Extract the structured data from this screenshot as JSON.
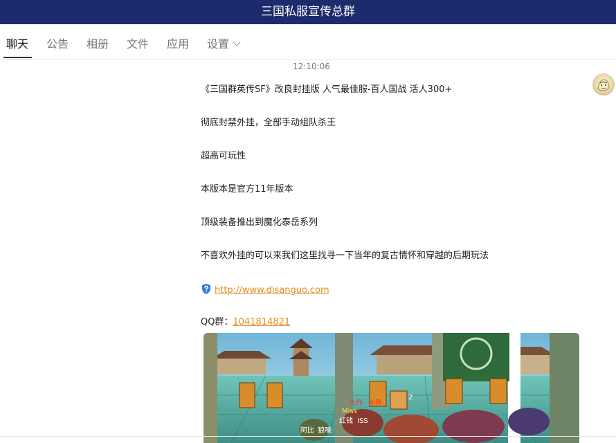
{
  "window": {
    "title": "三国私服宣传总群"
  },
  "tabs": [
    {
      "label": "聊天",
      "active": true
    },
    {
      "label": "公告"
    },
    {
      "label": "相册"
    },
    {
      "label": "文件"
    },
    {
      "label": "应用"
    },
    {
      "label": "设置"
    }
  ],
  "chat": {
    "timestamp": "12:10:06",
    "lines": [
      "《三国群英传SF》改良封挂版 人气最佳服-百人国战 活人300+",
      "彻底封禁外挂，全部手动组队杀王",
      "超高可玩性",
      "本版本是官方11年版本",
      "顶级装备推出到魔化泰岳系列",
      "不喜欢外挂的可以来我们这里找寻一下当年的复古情怀和穿越的后期玩法"
    ],
    "link": "http://www.disanguo.com",
    "qq_label": "QQ群：",
    "qq_number": "1041814821",
    "game_labels": [
      "大乔",
      "大乔",
      "2",
      "阿比",
      "狼嚎",
      "Miss",
      "红钱",
      "ISS"
    ]
  },
  "colors": {
    "titlebar": "#1c2b6b",
    "link": "#e8891a",
    "active_tab": "#111111",
    "inactive_tab": "#777777"
  }
}
